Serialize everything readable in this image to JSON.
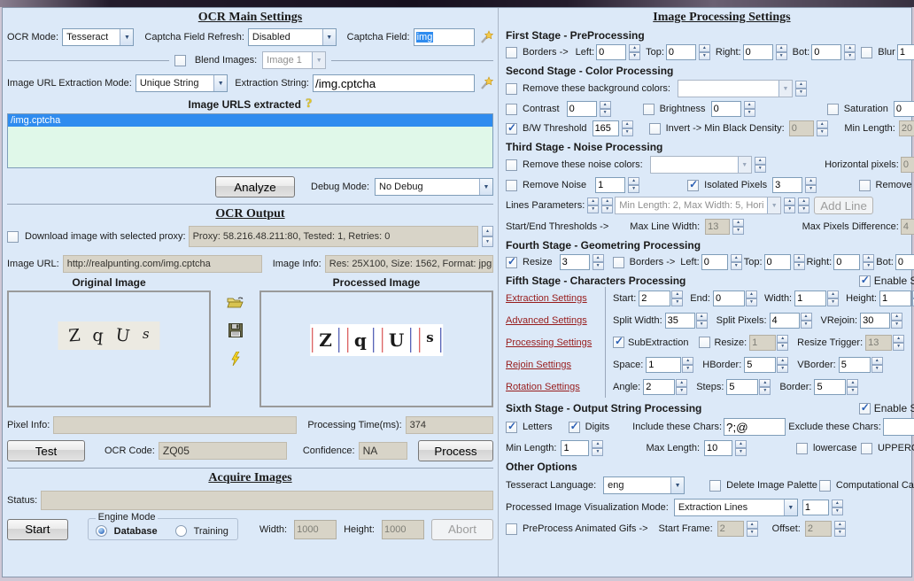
{
  "left": {
    "title": "OCR Main Settings",
    "ocr_mode": {
      "label": "OCR Mode:",
      "value": "Tesseract"
    },
    "captcha_refresh": {
      "label": "Captcha Field Refresh:",
      "value": "Disabled"
    },
    "captcha_field": {
      "label": "Captcha Field:",
      "value": "img"
    },
    "blend": {
      "label": "Blend Images:",
      "value": "Image 1"
    },
    "url_mode": {
      "label": "Image URL Extraction Mode:",
      "value": "Unique String"
    },
    "extraction": {
      "label": "Extraction String:",
      "value": "/img.cptcha"
    },
    "urls_header": "Image URLS extracted",
    "url_item": "/img.cptcha",
    "analyze_button": "Analyze",
    "debug": {
      "label": "Debug Mode:",
      "value": "No Debug"
    },
    "output_title": "OCR Output",
    "proxy": {
      "label": "Download image with selected proxy:",
      "value": "Proxy: 58.216.48.211:80, Tested: 1, Retries: 0"
    },
    "image_url": {
      "label": "Image URL:",
      "value": "http://realpunting.com/img.cptcha"
    },
    "image_info": {
      "label": "Image Info:",
      "value": "Res: 25X100, Size: 1562, Format: jpg"
    },
    "original_label": "Original Image",
    "processed_label": "Processed Image",
    "captcha": {
      "c0": "Z",
      "c1": "q",
      "c2": "U",
      "c3": "s"
    },
    "pixel_info": {
      "label": "Pixel Info:",
      "value": ""
    },
    "processing_time": {
      "label": "Processing Time(ms):",
      "value": "374"
    },
    "test_button": "Test",
    "ocr_code": {
      "label": "OCR Code:",
      "value": "ZQ05"
    },
    "confidence": {
      "label": "Confidence:",
      "value": "NA"
    },
    "process_button": "Process",
    "acquire_title": "Acquire Images",
    "status": {
      "label": "Status:",
      "value": ""
    },
    "start_button": "Start",
    "engine_mode": {
      "label": "Engine Mode",
      "database": "Database",
      "training": "Training"
    },
    "width": {
      "label": "Width:",
      "value": "1000"
    },
    "height": {
      "label": "Height:",
      "value": "1000"
    },
    "abort_button": "Abort"
  },
  "right": {
    "title": "Image Processing Settings",
    "stage1": {
      "title": "First Stage - PreProcessing",
      "borders_label": "Borders ->",
      "left": {
        "label": "Left:",
        "value": "0"
      },
      "top": {
        "label": "Top:",
        "value": "0"
      },
      "right": {
        "label": "Right:",
        "value": "0"
      },
      "bot": {
        "label": "Bot:",
        "value": "0"
      },
      "blur": {
        "label": "Blur",
        "value": "1"
      }
    },
    "stage2": {
      "title": "Second Stage - Color Processing",
      "remove_bg_label": "Remove these background colors:",
      "contrast": {
        "label": "Contrast",
        "value": "0"
      },
      "brightness": {
        "label": "Brightness",
        "value": "0"
      },
      "saturation": {
        "label": "Saturation",
        "value": "0"
      },
      "bw_threshold": {
        "label": "B/W Threshold",
        "value": "165"
      },
      "invert": {
        "label": "Invert -> Min Black Density:",
        "value": "0"
      },
      "min_length": {
        "label": "Min Length:",
        "value": "20"
      }
    },
    "stage3": {
      "title": "Third Stage - Noise Processing",
      "remove_noise_colors_label": "Remove these noise colors:",
      "horizontal_pixels": {
        "label": "Horizontal pixels:",
        "value": "0"
      },
      "remove_noise": {
        "label": "Remove Noise",
        "value": "1"
      },
      "isolated_pixels": {
        "label": "Isolated Pixels",
        "value": "3"
      },
      "remove_lines_label": "Remove Lines",
      "lines_params": {
        "label": "Lines Parameters:",
        "value": "Min Length: 2, Max Width: 5, Horizontal"
      },
      "add_line_button": "Add Line",
      "thresholds_label": "Start/End Thresholds ->",
      "max_line_width": {
        "label": "Max Line Width:",
        "value": "13"
      },
      "max_pixels_diff": {
        "label": "Max Pixels Difference:",
        "value": "4"
      }
    },
    "stage4": {
      "title": "Fourth Stage - Geometring Processing",
      "resize": {
        "label": "Resize",
        "value": "3"
      },
      "borders_label": "Borders ->",
      "left": {
        "label": "Left:",
        "value": "0"
      },
      "top": {
        "label": "Top:",
        "value": "0"
      },
      "right": {
        "label": "Right:",
        "value": "0"
      },
      "bot": {
        "label": "Bot:",
        "value": "0"
      }
    },
    "stage5": {
      "title": "Fifth Stage - Characters Processing",
      "enable_stage": "Enable Stage",
      "extraction": {
        "link": "Extraction Settings",
        "start": {
          "label": "Start:",
          "value": "2"
        },
        "end": {
          "label": "End:",
          "value": "0"
        },
        "width": {
          "label": "Width:",
          "value": "1"
        },
        "height": {
          "label": "Height:",
          "value": "1"
        }
      },
      "advanced": {
        "link": "Advanced Settings",
        "split_width": {
          "label": "Split Width:",
          "value": "35"
        },
        "split_pixels": {
          "label": "Split Pixels:",
          "value": "4"
        },
        "vrejoin": {
          "label": "VRejoin:",
          "value": "30"
        }
      },
      "processing": {
        "link": "Processing Settings",
        "subextraction_label": "SubExtraction",
        "resize": {
          "label": "Resize:",
          "value": "1"
        },
        "resize_trigger": {
          "label": "Resize Trigger:",
          "value": "13"
        }
      },
      "rejoin": {
        "link": "Rejoin Settings",
        "space": {
          "label": "Space:",
          "value": "1"
        },
        "hborder": {
          "label": "HBorder:",
          "value": "5"
        },
        "vborder": {
          "label": "VBorder:",
          "value": "5"
        }
      },
      "rotation": {
        "link": "Rotation Settings",
        "angle": {
          "label": "Angle:",
          "value": "2"
        },
        "steps": {
          "label": "Steps:",
          "value": "5"
        },
        "border": {
          "label": "Border:",
          "value": "5"
        }
      }
    },
    "stage6": {
      "title": "Sixth Stage - Output String Processing",
      "enable_stage": "Enable Stage",
      "letters_label": "Letters",
      "digits_label": "Digits",
      "include_chars": {
        "label": "Include these Chars:",
        "value": "?;@"
      },
      "exclude_chars": {
        "label": "Exclude these Chars:",
        "value": ""
      },
      "min_length": {
        "label": "Min Length:",
        "value": "1"
      },
      "max_length": {
        "label": "Max Length:",
        "value": "10"
      },
      "lowercase_label": "lowercase",
      "uppercase_label": "UPPERCASE"
    },
    "other": {
      "title": "Other Options",
      "tesseract_lang": {
        "label": "Tesseract Language:",
        "value": "eng"
      },
      "delete_palette_label": "Delete Image Palette",
      "computational_label": "Computational Captcha",
      "viz_mode": {
        "label": "Processed Image Visualization Mode:",
        "value": "Extraction Lines",
        "num": "1"
      },
      "preprocess_gifs_label": "PreProcess Animated Gifs ->",
      "start_frame": {
        "label": "Start Frame:",
        "value": "2"
      },
      "offset": {
        "label": "Offset:",
        "value": "2"
      }
    }
  }
}
